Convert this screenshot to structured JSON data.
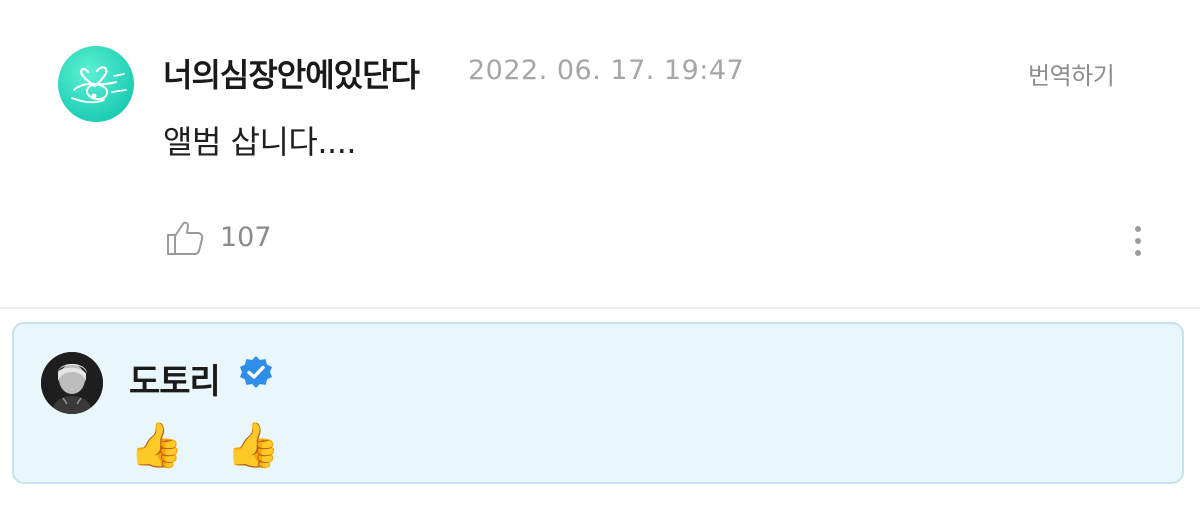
{
  "comment": {
    "username": "너의심장안에있단다",
    "timestamp": "2022. 06. 17. 19:47",
    "translate_label": "번역하기",
    "text": "앨범 삽니다....",
    "like_count": "107"
  },
  "reply": {
    "username": "도토리",
    "verified": true,
    "text": "👍 👍"
  },
  "icons": {
    "like": "thumbs-up-outline-icon",
    "more": "vertical-ellipsis-icon",
    "verified": "verified-badge-icon"
  },
  "colors": {
    "avatar_teal": "#22d1b8",
    "reply_background": "#e9f6fc",
    "verified_blue": "#2f8fe8",
    "meta_gray": "#a6a6a6"
  }
}
